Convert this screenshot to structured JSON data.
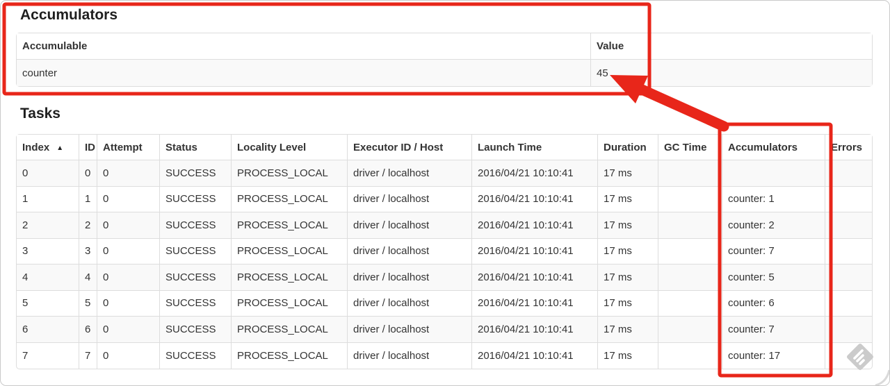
{
  "accumulators_section": {
    "title": "Accumulators",
    "table": {
      "headers": [
        "Accumulable",
        "Value"
      ],
      "rows": [
        {
          "accumulable": "counter",
          "value": "45"
        }
      ]
    }
  },
  "tasks_section": {
    "title": "Tasks",
    "table": {
      "headers": [
        "Index",
        "ID",
        "Attempt",
        "Status",
        "Locality Level",
        "Executor ID / Host",
        "Launch Time",
        "Duration",
        "GC Time",
        "Accumulators",
        "Errors"
      ],
      "sort_icon": "▲",
      "rows": [
        [
          "0",
          "0",
          "0",
          "SUCCESS",
          "PROCESS_LOCAL",
          "driver / localhost",
          "2016/04/21 10:10:41",
          "17 ms",
          "",
          "",
          ""
        ],
        [
          "1",
          "1",
          "0",
          "SUCCESS",
          "PROCESS_LOCAL",
          "driver / localhost",
          "2016/04/21 10:10:41",
          "17 ms",
          "",
          "counter: 1",
          ""
        ],
        [
          "2",
          "2",
          "0",
          "SUCCESS",
          "PROCESS_LOCAL",
          "driver / localhost",
          "2016/04/21 10:10:41",
          "17 ms",
          "",
          "counter: 2",
          ""
        ],
        [
          "3",
          "3",
          "0",
          "SUCCESS",
          "PROCESS_LOCAL",
          "driver / localhost",
          "2016/04/21 10:10:41",
          "17 ms",
          "",
          "counter: 7",
          ""
        ],
        [
          "4",
          "4",
          "0",
          "SUCCESS",
          "PROCESS_LOCAL",
          "driver / localhost",
          "2016/04/21 10:10:41",
          "17 ms",
          "",
          "counter: 5",
          ""
        ],
        [
          "5",
          "5",
          "0",
          "SUCCESS",
          "PROCESS_LOCAL",
          "driver / localhost",
          "2016/04/21 10:10:41",
          "17 ms",
          "",
          "counter: 6",
          ""
        ],
        [
          "6",
          "6",
          "0",
          "SUCCESS",
          "PROCESS_LOCAL",
          "driver / localhost",
          "2016/04/21 10:10:41",
          "17 ms",
          "",
          "counter: 7",
          ""
        ],
        [
          "7",
          "7",
          "0",
          "SUCCESS",
          "PROCESS_LOCAL",
          "driver / localhost",
          "2016/04/21 10:10:41",
          "17 ms",
          "",
          "counter: 17",
          ""
        ]
      ]
    }
  },
  "annotation": {
    "color": "#e8261a",
    "accumulators_box": "highlight around Accumulators summary table",
    "column_box": "highlight around Accumulators task column",
    "arrow": "points from Accumulators column to total value 45"
  },
  "watermark": {
    "icon_color": "#cbcbcb"
  },
  "colors": {
    "row_stripe": "#f9f9f9",
    "table_border": "#dddddd",
    "text": "#333333",
    "frame_border": "#c9c9c9"
  }
}
